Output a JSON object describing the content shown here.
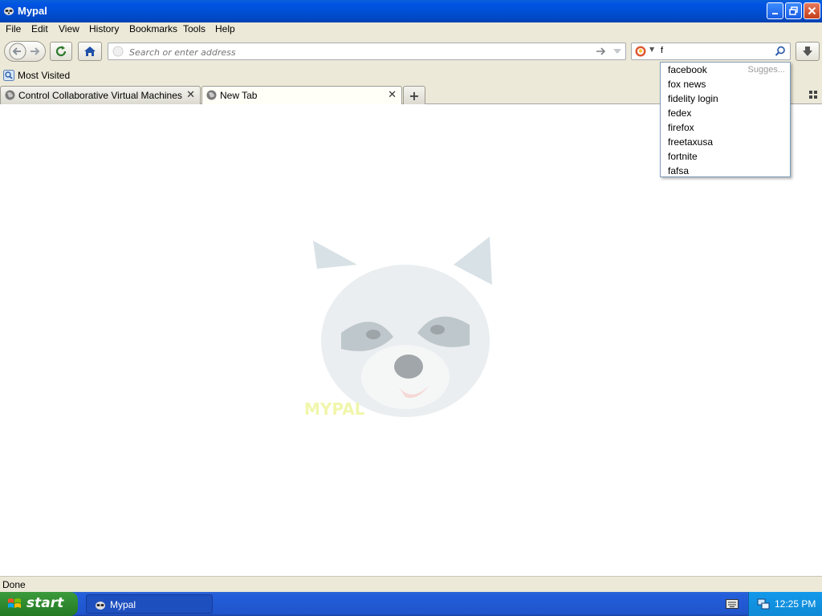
{
  "window": {
    "title": "Mypal"
  },
  "menu": [
    "File",
    "Edit",
    "View",
    "History",
    "Bookmarks",
    "Tools",
    "Help"
  ],
  "urlbar": {
    "placeholder": "Search or enter address",
    "value": ""
  },
  "search": {
    "text": "f",
    "engine_icon": "duckduckgo-icon"
  },
  "bookmarks": {
    "most_visited": "Most Visited"
  },
  "tabs": [
    {
      "label": "Control Collaborative Virtual Machines!",
      "active": false
    },
    {
      "label": "New Tab",
      "active": true
    }
  ],
  "suggestions": {
    "header": "Sugges...",
    "items": [
      "facebook",
      "fox news",
      "fidelity login",
      "fedex",
      "firefox",
      "freetaxusa",
      "fortnite",
      "fafsa"
    ]
  },
  "status": {
    "text": "Done"
  },
  "taskbar": {
    "start_label": "start",
    "items": [
      {
        "label": "Mypal"
      }
    ],
    "clock": "12:25 PM"
  },
  "colors": {
    "titlebar": "#0054e3",
    "taskbar": "#245edb",
    "start_button": "#2f8a2f",
    "tray": "#0f8ad6"
  }
}
